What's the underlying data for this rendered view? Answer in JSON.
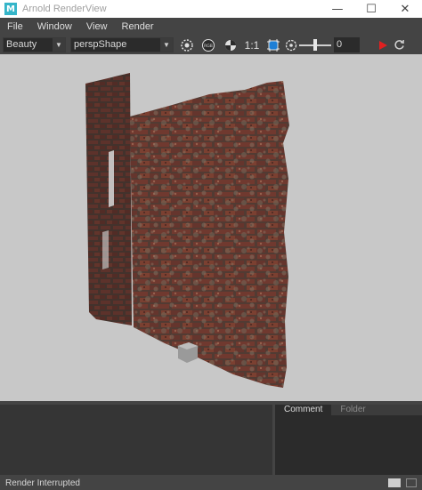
{
  "window": {
    "app_icon": "M",
    "title": "Arnold RenderView",
    "minimize": "—",
    "maximize": "☐",
    "close": "✕"
  },
  "menu": {
    "items": [
      "File",
      "Window",
      "View",
      "Render"
    ]
  },
  "toolbar": {
    "aov_value": "Beauty",
    "camera_value": "perspShape",
    "ratio_label": "1:1",
    "exposure_value": "0",
    "icons": [
      "region-icon",
      "rgb-icon",
      "alpha-contrast-icon",
      "ratio-label",
      "crop-region-icon",
      "exposure-icon",
      "exposure-slider",
      "render-play-icon",
      "refresh-icon"
    ],
    "play_color": "#e02020"
  },
  "viewport": {
    "background": "#c8c8c8",
    "content": "render-brick-wall"
  },
  "tabs": {
    "items": [
      "Comment",
      "Folder"
    ],
    "active": "Comment"
  },
  "status": {
    "text": "Render Interrupted"
  }
}
